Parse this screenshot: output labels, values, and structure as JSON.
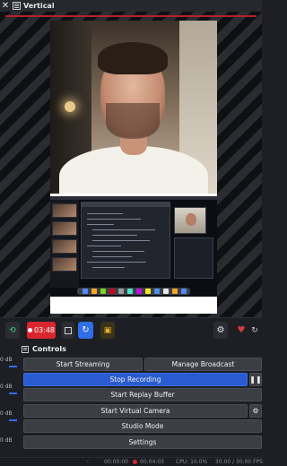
{
  "window": {
    "title": "Vertical",
    "close_icon": "x-icon",
    "title_icon": "document-icon"
  },
  "toolbar": {
    "record_time": "03:48",
    "colors": {
      "recording": "#d9262e",
      "active_toggle": "#2f6ee6",
      "stream_icon": "#3fae6b",
      "virtual_cam": "#e0b020"
    }
  },
  "audio_meters": [
    "0 dB",
    "0 dB",
    "0 dB",
    "0 dB"
  ],
  "controls": {
    "title": "Controls",
    "start_streaming": "Start Streaming",
    "manage_broadcast": "Manage Broadcast",
    "stop_recording": "Stop Recording",
    "start_replay_buffer": "Start Replay Buffer",
    "start_virtual_camera": "Start Virtual Camera",
    "studio_mode": "Studio Mode",
    "settings": "Settings"
  },
  "status": {
    "stream_time": "00:00:00",
    "record_time": "00:04:03",
    "cpu": "CPU: 10.0%",
    "fps": "30.00 / 30.00 FPS"
  }
}
